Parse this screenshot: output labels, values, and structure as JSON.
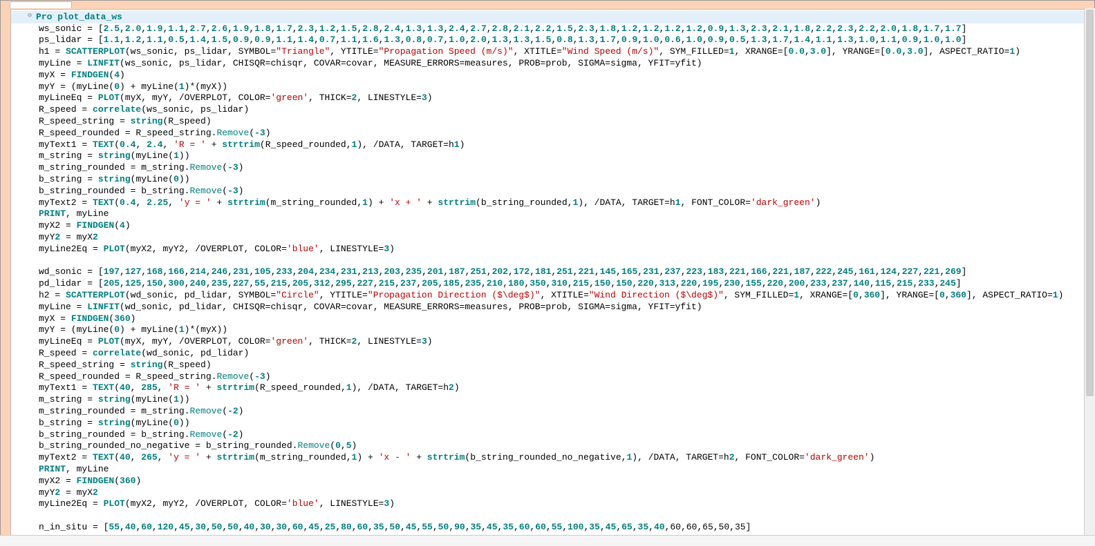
{
  "proc_decl": {
    "keyword": "Pro",
    "name": "plot_data_ws"
  },
  "lines": [
    {
      "type": "array_assign",
      "var": "ws_sonic",
      "values": "2.5,2.0,1.9,1.1,2.7,2.6,1.9,1.8,1.7,2.3,1.2,1.5,2.8,2.4,1.3,1.3,2.4,2.7,2.8,2.1,2.2,1.5,2.3,1.8,1.2,1.2,1.2,1.2,0.9,1.3,2.3,2.1,1.8,2.2,2.3,2.2,2.0,1.8,1.7,1.7"
    },
    {
      "type": "array_assign",
      "var": "ps_lidar",
      "values": "1.1,1.2,1.1,0.5,1.4,1.5,0.9,0.9,1.1,1.4,0.7,1.1,1.6,1.3,0.8,0.7,1.0,2.0,1.3,1.3,1.5,0.8,1.3,1.7,0.9,1.0,0.6,1.0,0.9,0.5,1.3,1.7,1.4,1.1,1.3,1.0,1.1,0.9,1.0,1.0"
    },
    {
      "type": "scatterplot",
      "var": "h1",
      "args": "ws_sonic, ps_lidar",
      "symbol": "Triangle",
      "ytitle": "Propagation Speed (m/s)",
      "xtitle": "Wind Speed (m/s)",
      "sym_filled": "1",
      "xrange": "0.0,3.0",
      "yrange": "0.0,3.0",
      "aspect": "1"
    },
    {
      "type": "linfit",
      "var": "myLine",
      "target": "ws_sonic, ps_lidar",
      "rest": "CHISQR=chisqr, COVAR=covar, MEASURE_ERRORS=measures, PROB=prob, SIGMA=sigma, YFIT=yfit"
    },
    {
      "type": "findgen",
      "var": "myX",
      "n": "4"
    },
    {
      "type": "expr",
      "text": "myY = (myLine(0) + myLine(1)*(myX))"
    },
    {
      "type": "plot_call",
      "var": "myLineEq",
      "args": "myX, myY, /OVERPLOT",
      "color": "green",
      "rest": ", THICK=2, LINESTYLE=3"
    },
    {
      "type": "correlate",
      "var": "R_speed",
      "args": "ws_sonic, ps_lidar"
    },
    {
      "type": "string_call",
      "var": "R_speed_string",
      "arg": "R_speed"
    },
    {
      "type": "remove",
      "var": "R_speed_rounded",
      "src": "R_speed_string",
      "n": "-3"
    },
    {
      "type": "text_call",
      "var": "myText1",
      "xy": "0.4, 2.4",
      "prefix": "'R = '",
      "strtrim_arg": "R_speed_rounded,1",
      "rest": ", /DATA, TARGET=h1"
    },
    {
      "type": "string_call",
      "var": "m_string",
      "arg": "myLine(1)"
    },
    {
      "type": "remove",
      "var": "m_string_rounded",
      "src": "m_string",
      "n": "-3"
    },
    {
      "type": "string_call",
      "var": "b_string",
      "arg": "myLine(0)"
    },
    {
      "type": "remove",
      "var": "b_string_rounded",
      "src": "b_string",
      "n": "-3"
    },
    {
      "type": "text_call2",
      "var": "myText2",
      "xy": "0.4, 2.25",
      "prefix": "'y = '",
      "arg1": "m_string_rounded,1",
      "mid": "'x + '",
      "arg2": "b_string_rounded,1",
      "rest": ", /DATA, TARGET=h1",
      "font_color": "dark_green"
    },
    {
      "type": "print",
      "text": "PRINT, myLine"
    },
    {
      "type": "findgen",
      "var": "myX2",
      "n": "4"
    },
    {
      "type": "expr",
      "text": "myY2 = myX2"
    },
    {
      "type": "plot_call",
      "var": "myLine2Eq",
      "args": "myX2, myY2, /OVERPLOT",
      "color": "blue",
      "rest": ", LINESTYLE=3"
    },
    {
      "type": "blank"
    },
    {
      "type": "array_assign",
      "var": "wd_sonic",
      "values": "197,127,168,166,214,246,231,105,233,204,234,231,213,203,235,201,187,251,202,172,181,251,221,145,165,231,237,223,183,221,166,221,187,222,245,161,124,227,221,269"
    },
    {
      "type": "array_assign",
      "var": "pd_lidar",
      "values": "205,125,150,300,240,235,227,55,215,205,312,295,227,215,237,205,185,235,210,180,350,310,215,150,150,220,313,220,195,230,155,220,200,233,237,140,115,215,233,245"
    },
    {
      "type": "scatterplot",
      "var": "h2",
      "args": "wd_sonic, pd_lidar",
      "symbol": "Circle",
      "ytitle": "Propagation Direction ($\\deg$)",
      "xtitle": "Wind Direction ($\\deg$)",
      "sym_filled": "1",
      "xrange": "0,360",
      "yrange": "0,360",
      "aspect": "1"
    },
    {
      "type": "linfit",
      "var": "myLine",
      "target": "wd_sonic, pd_lidar",
      "rest": "CHISQR=chisqr, COVAR=covar, MEASURE_ERRORS=measures, PROB=prob, SIGMA=sigma, YFIT=yfit"
    },
    {
      "type": "findgen",
      "var": "myX",
      "n": "360"
    },
    {
      "type": "expr",
      "text": "myY = (myLine(0) + myLine(1)*(myX))"
    },
    {
      "type": "plot_call",
      "var": "myLineEq",
      "args": "myX, myY, /OVERPLOT",
      "color": "green",
      "rest": ", THICK=2, LINESTYLE=3"
    },
    {
      "type": "correlate",
      "var": "R_speed",
      "args": "wd_sonic, pd_lidar"
    },
    {
      "type": "string_call",
      "var": "R_speed_string",
      "arg": "R_speed"
    },
    {
      "type": "remove",
      "var": "R_speed_rounded",
      "src": "R_speed_string",
      "n": "-3"
    },
    {
      "type": "text_call",
      "var": "myText1",
      "xy": "40, 285",
      "prefix": "'R = '",
      "strtrim_arg": "R_speed_rounded,1",
      "rest": ", /DATA, TARGET=h2"
    },
    {
      "type": "string_call",
      "var": "m_string",
      "arg": "myLine(1)"
    },
    {
      "type": "remove",
      "var": "m_string_rounded",
      "src": "m_string",
      "n": "-2"
    },
    {
      "type": "string_call",
      "var": "b_string",
      "arg": "myLine(0)"
    },
    {
      "type": "remove",
      "var": "b_string_rounded",
      "src": "b_string",
      "n": "-2"
    },
    {
      "type": "remove2",
      "var": "b_string_rounded_no_negative",
      "src": "b_string_rounded",
      "n": "0,5"
    },
    {
      "type": "text_call2",
      "var": "myText2",
      "xy": "40, 265",
      "prefix": "'y = '",
      "arg1": "m_string_rounded,1",
      "mid": "'x - '",
      "arg2": "b_string_rounded_no_negative,1",
      "rest": ", /DATA, TARGET=h2",
      "font_color": "dark_green"
    },
    {
      "type": "print",
      "text": "PRINT, myLine"
    },
    {
      "type": "findgen",
      "var": "myX2",
      "n": "360"
    },
    {
      "type": "expr",
      "text": "myY2 = myX2"
    },
    {
      "type": "plot_call",
      "var": "myLine2Eq",
      "args": "myX2, myY2, /OVERPLOT",
      "color": "blue",
      "rest": ", LINESTYLE=3"
    },
    {
      "type": "blank"
    },
    {
      "type": "array_partial",
      "var": "n_in_situ",
      "before": "55,40,60,120,45,30,50,50,40,30,30,60,45,25,80,60,35,50,45,55,50,90,35,45,35,60,60,55,100,35,45,65,35,40",
      "after": ",60,60,65,50,35"
    }
  ]
}
